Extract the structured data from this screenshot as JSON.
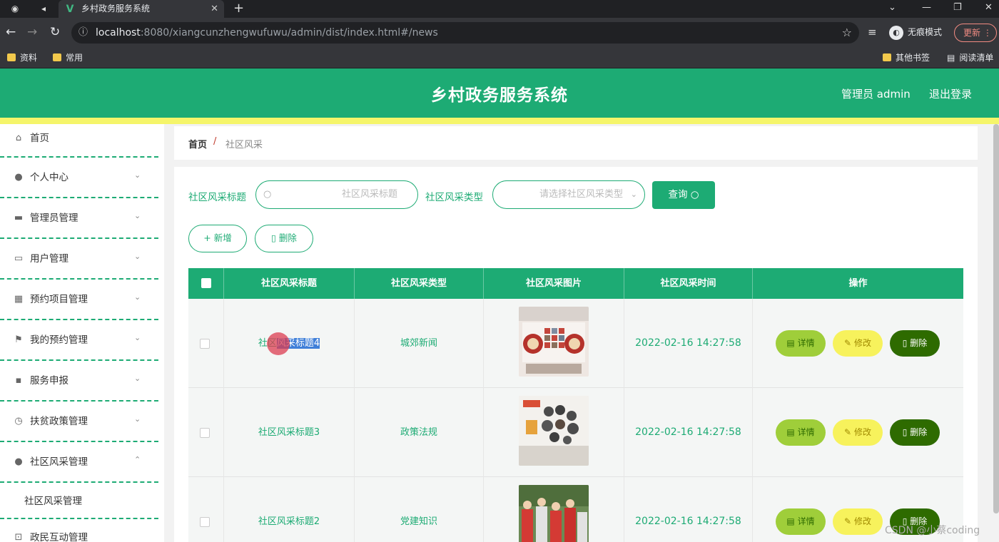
{
  "browser": {
    "tab_title": "乡村政务服务系统",
    "url_host": "localhost",
    "url_rest": ":8080/xiangcunzhengwufuwu/admin/dist/index.html#/news",
    "incognito_label": "无痕模式",
    "update_label": "更新",
    "bookmarks": [
      "资料",
      "常用"
    ],
    "bookmarks_right": [
      "其他书签",
      "阅读清单"
    ]
  },
  "header": {
    "title": "乡村政务服务系统",
    "user_label": "管理员 admin",
    "logout_label": "退出登录",
    "color": "#1dab74"
  },
  "sidebar": {
    "items": [
      {
        "label": "首页",
        "icon": "home-icon"
      },
      {
        "label": "个人中心",
        "icon": "user-icon"
      },
      {
        "label": "管理员管理",
        "icon": "briefcase-icon"
      },
      {
        "label": "用户管理",
        "icon": "chat-icon"
      },
      {
        "label": "预约项目管理",
        "icon": "grid-icon"
      },
      {
        "label": "我的预约管理",
        "icon": "flag-icon"
      },
      {
        "label": "服务申报",
        "icon": "message-icon"
      },
      {
        "label": "扶贫政策管理",
        "icon": "clock-icon"
      },
      {
        "label": "社区风采管理",
        "icon": "user-icon"
      },
      {
        "label": "政民互动管理",
        "icon": "share-icon"
      }
    ],
    "sub_item": "社区风采管理"
  },
  "breadcrumb": {
    "home": "首页",
    "sep": "/",
    "current": "社区风采"
  },
  "filters": {
    "title_label": "社区风采标题",
    "title_placeholder": "社区风采标题",
    "type_label": "社区风采类型",
    "type_placeholder": "请选择社区风采类型",
    "query_label": "查询"
  },
  "actions": {
    "add_label": "新增",
    "delete_label": "删除"
  },
  "table": {
    "headers": [
      "社区风采标题",
      "社区风采类型",
      "社区风采图片",
      "社区风采时间",
      "操作"
    ],
    "row_actions": {
      "detail": "详情",
      "edit": "修改",
      "delete": "删除"
    },
    "rows": [
      {
        "title_a": "社区",
        "title_b": "风采标题4",
        "type": "城郊新闻",
        "time": "2022-02-16 14:27:58"
      },
      {
        "title": "社区风采标题3",
        "type": "政策法规",
        "time": "2022-02-16 14:27:58"
      },
      {
        "title": "社区风采标题2",
        "type": "党建知识",
        "time": "2022-02-16 14:27:58"
      }
    ]
  },
  "watermark": "CSDN @小蔡coding"
}
